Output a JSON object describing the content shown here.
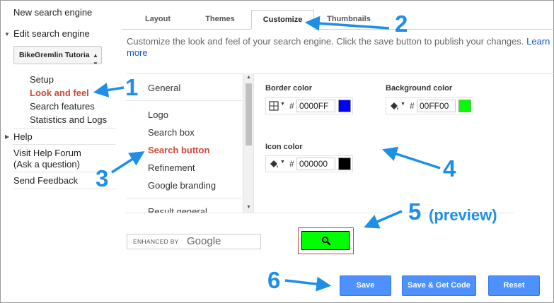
{
  "sidebar": {
    "new_engine": "New search engine",
    "edit_engine": "Edit search engine",
    "engine_select_value": "BikeGremlin Tutoria",
    "sub_items": [
      {
        "label": "Setup"
      },
      {
        "label": "Look and feel"
      },
      {
        "label": "Search features"
      },
      {
        "label": "Statistics and Logs"
      }
    ],
    "help": "Help",
    "visit_forum": "Visit Help Forum",
    "ask_question": "(Ask a question)",
    "send_feedback": "Send Feedback"
  },
  "tabs": [
    {
      "label": "Layout"
    },
    {
      "label": "Themes"
    },
    {
      "label": "Customize"
    },
    {
      "label": "Thumbnails"
    }
  ],
  "intro": {
    "text": "Customize the look and feel of your search engine. Click the save button to publish your changes. ",
    "learn_more": "Learn more"
  },
  "categories": [
    {
      "label": "General"
    },
    {
      "label": "Logo"
    },
    {
      "label": "Search box"
    },
    {
      "label": "Search button"
    },
    {
      "label": "Refinement"
    },
    {
      "label": "Google branding"
    },
    {
      "label": "Result general"
    }
  ],
  "colors": {
    "border": {
      "label": "Border color",
      "hash": "#",
      "value": "0000FF",
      "swatch": "#0000ff",
      "icon": "border-grid-icon"
    },
    "background": {
      "label": "Background color",
      "hash": "#",
      "value": "00FF00",
      "swatch": "#00ff00",
      "icon": "paint-bucket-icon"
    },
    "icon": {
      "label": "Icon color",
      "hash": "#",
      "value": "000000",
      "swatch": "#000000",
      "icon": "paint-bucket-icon"
    }
  },
  "preview": {
    "enhanced_by": "ENHANCED BY",
    "google": "Google",
    "button_color": "#00ff00"
  },
  "buttons": {
    "save": "Save",
    "save_get_code": "Save & Get Code",
    "reset": "Reset"
  },
  "annotations": {
    "n1": "1",
    "n2": "2",
    "n3": "3",
    "n4": "4",
    "n5": "5",
    "n6": "6",
    "preview_label": "(preview)",
    "color": "#1e8fe6"
  }
}
